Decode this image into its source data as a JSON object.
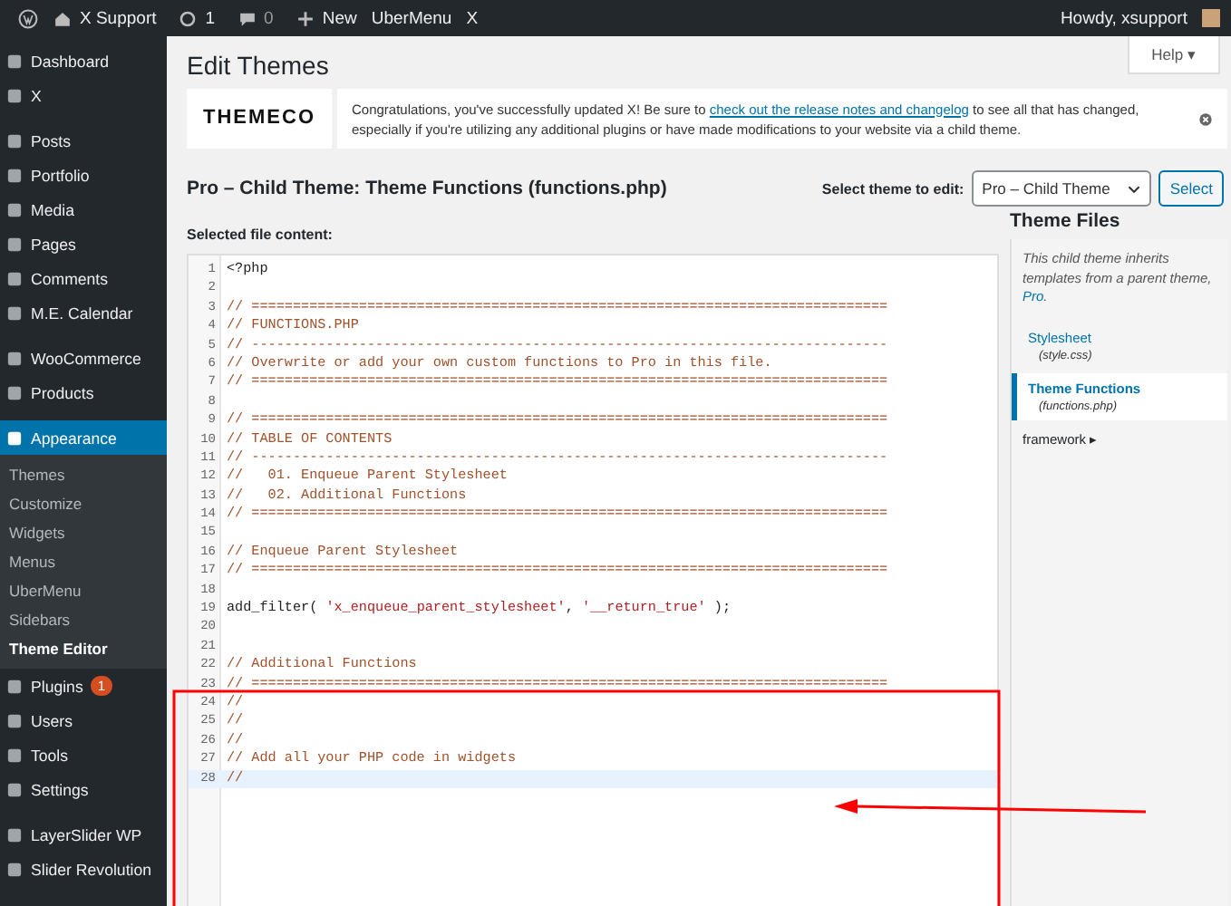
{
  "admin_bar": {
    "site": "X Support",
    "updates": "1",
    "comments": "0",
    "new": "New",
    "items": [
      "UberMenu",
      "X"
    ],
    "greeting": "Howdy, xsupport"
  },
  "sidebar": {
    "groups": [
      [
        {
          "label": "Dashboard",
          "selected": false
        },
        {
          "label": "X",
          "selected": false
        }
      ],
      [
        {
          "label": "Posts",
          "selected": false
        },
        {
          "label": "Portfolio",
          "selected": false
        },
        {
          "label": "Media",
          "selected": false
        },
        {
          "label": "Pages",
          "selected": false
        },
        {
          "label": "Comments",
          "selected": false
        },
        {
          "label": "M.E. Calendar",
          "selected": false
        }
      ],
      [
        {
          "label": "WooCommerce",
          "selected": false
        },
        {
          "label": "Products",
          "selected": false
        }
      ],
      [
        {
          "label": "Appearance",
          "selected": true,
          "children": [
            {
              "label": "Themes",
              "selected": false
            },
            {
              "label": "Customize",
              "selected": false
            },
            {
              "label": "Widgets",
              "selected": false
            },
            {
              "label": "Menus",
              "selected": false
            },
            {
              "label": "UberMenu",
              "selected": false
            },
            {
              "label": "Sidebars",
              "selected": false
            },
            {
              "label": "Theme Editor",
              "selected": true
            }
          ]
        },
        {
          "label": "Plugins",
          "selected": false,
          "badge": "1"
        },
        {
          "label": "Users",
          "selected": false
        },
        {
          "label": "Tools",
          "selected": false
        },
        {
          "label": "Settings",
          "selected": false
        }
      ],
      [
        {
          "label": "LayerSlider WP",
          "selected": false
        },
        {
          "label": "Slider Revolution",
          "selected": false
        }
      ]
    ]
  },
  "help": "Help ▾",
  "title": "Edit Themes",
  "notice": {
    "logo": "THEMECO",
    "before": "Congratulations, you've successfully updated X! Be sure to ",
    "link": "check out the release notes and changelog",
    "after": " to see all that has changed, especially if you're utilizing any additional plugins or have made modifications to your website via a child theme."
  },
  "file_heading": "Pro – Child Theme: Theme Functions (functions.php)",
  "theme_select": {
    "label": "Select theme to edit:",
    "value": "Pro – Child Theme",
    "button": "Select"
  },
  "content_label": "Selected file content:",
  "editor": {
    "lines": [
      {
        "no": "1",
        "kind": "code",
        "text": "<?php",
        "active": false
      },
      {
        "no": "2",
        "kind": "blank",
        "active": false
      },
      {
        "no": "3",
        "kind": "comment",
        "text": "// =============================================================================",
        "active": false
      },
      {
        "no": "4",
        "kind": "comment",
        "text": "// FUNCTIONS.PHP",
        "active": false
      },
      {
        "no": "5",
        "kind": "comment",
        "text": "// -----------------------------------------------------------------------------",
        "active": false
      },
      {
        "no": "6",
        "kind": "comment",
        "text": "// Overwrite or add your own custom functions to Pro in this file.",
        "active": false
      },
      {
        "no": "7",
        "kind": "comment",
        "text": "// =============================================================================",
        "active": false
      },
      {
        "no": "8",
        "kind": "blank",
        "active": false
      },
      {
        "no": "9",
        "kind": "comment",
        "text": "// =============================================================================",
        "active": false
      },
      {
        "no": "10",
        "kind": "comment",
        "text": "// TABLE OF CONTENTS",
        "active": false
      },
      {
        "no": "11",
        "kind": "comment",
        "text": "// -----------------------------------------------------------------------------",
        "active": false
      },
      {
        "no": "12",
        "kind": "comment",
        "text": "//   01. Enqueue Parent Stylesheet",
        "active": false
      },
      {
        "no": "13",
        "kind": "comment",
        "text": "//   02. Additional Functions",
        "active": false
      },
      {
        "no": "14",
        "kind": "comment",
        "text": "// =============================================================================",
        "active": false
      },
      {
        "no": "15",
        "kind": "blank",
        "active": false
      },
      {
        "no": "16",
        "kind": "comment",
        "text": "// Enqueue Parent Stylesheet",
        "active": false
      },
      {
        "no": "17",
        "kind": "comment",
        "text": "// =============================================================================",
        "active": false
      },
      {
        "no": "18",
        "kind": "blank",
        "active": false
      },
      {
        "no": "19",
        "kind": "mixed",
        "parts": [
          {
            "kind": "code",
            "text": "add_filter( "
          },
          {
            "kind": "string",
            "text": "'x_enqueue_parent_stylesheet'"
          },
          {
            "kind": "code",
            "text": ", "
          },
          {
            "kind": "string",
            "text": "'__return_true'"
          },
          {
            "kind": "code",
            "text": " );"
          }
        ],
        "active": false
      },
      {
        "no": "20",
        "kind": "blank",
        "active": false
      },
      {
        "no": "21",
        "kind": "blank",
        "active": false
      },
      {
        "no": "22",
        "kind": "comment",
        "text": "// Additional Functions",
        "active": false
      },
      {
        "no": "23",
        "kind": "comment",
        "text": "// =============================================================================",
        "active": false
      },
      {
        "no": "24",
        "kind": "comment",
        "text": "//",
        "active": false
      },
      {
        "no": "25",
        "kind": "comment",
        "text": "//",
        "active": false
      },
      {
        "no": "26",
        "kind": "comment",
        "text": "//",
        "active": false
      },
      {
        "no": "27",
        "kind": "comment",
        "text": "// Add all your PHP code in widgets",
        "active": false
      },
      {
        "no": "28",
        "kind": "comment",
        "text": "//",
        "active": true
      }
    ]
  },
  "theme_files": {
    "title": "Theme Files",
    "intro": "This child theme inherits templates from a parent theme, ",
    "intro_link": "Pro",
    "intro_end": ".",
    "files": [
      {
        "name": "Stylesheet",
        "file": "(style.css)",
        "selected": false
      },
      {
        "name": "Theme Functions",
        "file": "(functions.php)",
        "selected": true
      }
    ],
    "folder": "framework ▸"
  }
}
